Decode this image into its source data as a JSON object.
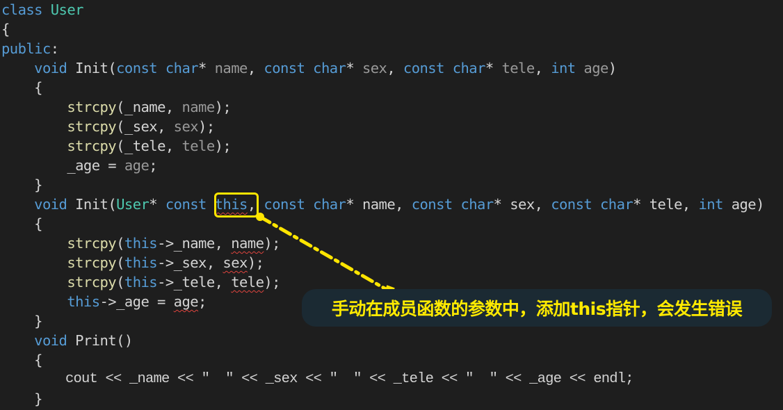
{
  "editor": {
    "language": "C++",
    "lines": [
      [
        {
          "t": "class",
          "c": "kw"
        },
        {
          "t": " ",
          "c": "plain"
        },
        {
          "t": "User",
          "c": "type"
        }
      ],
      [
        {
          "t": "{",
          "c": "punct"
        }
      ],
      [
        {
          "t": "public",
          "c": "kw"
        },
        {
          "t": ":",
          "c": "plain"
        }
      ],
      [
        {
          "t": "    ",
          "c": "plain"
        },
        {
          "t": "void",
          "c": "kw"
        },
        {
          "t": " ",
          "c": "plain"
        },
        {
          "t": "Init",
          "c": "plain"
        },
        {
          "t": "(",
          "c": "punct"
        },
        {
          "t": "const",
          "c": "kw"
        },
        {
          "t": " ",
          "c": "plain"
        },
        {
          "t": "char",
          "c": "kw"
        },
        {
          "t": "* ",
          "c": "plain"
        },
        {
          "t": "name",
          "c": "param-dim"
        },
        {
          "t": ", ",
          "c": "plain"
        },
        {
          "t": "const",
          "c": "kw"
        },
        {
          "t": " ",
          "c": "plain"
        },
        {
          "t": "char",
          "c": "kw"
        },
        {
          "t": "* ",
          "c": "plain"
        },
        {
          "t": "sex",
          "c": "param-dim"
        },
        {
          "t": ", ",
          "c": "plain"
        },
        {
          "t": "const",
          "c": "kw"
        },
        {
          "t": " ",
          "c": "plain"
        },
        {
          "t": "char",
          "c": "kw"
        },
        {
          "t": "* ",
          "c": "plain"
        },
        {
          "t": "tele",
          "c": "param-dim"
        },
        {
          "t": ", ",
          "c": "plain"
        },
        {
          "t": "int",
          "c": "kw"
        },
        {
          "t": " ",
          "c": "plain"
        },
        {
          "t": "age",
          "c": "param-dim"
        },
        {
          "t": ")",
          "c": "punct"
        }
      ],
      [
        {
          "t": "    {",
          "c": "punct"
        }
      ],
      [
        {
          "t": "        ",
          "c": "plain"
        },
        {
          "t": "strcpy",
          "c": "fn"
        },
        {
          "t": "(_name, ",
          "c": "plain"
        },
        {
          "t": "name",
          "c": "param-dim"
        },
        {
          "t": ");",
          "c": "plain"
        }
      ],
      [
        {
          "t": "        ",
          "c": "plain"
        },
        {
          "t": "strcpy",
          "c": "fn"
        },
        {
          "t": "(_sex, ",
          "c": "plain"
        },
        {
          "t": "sex",
          "c": "param-dim"
        },
        {
          "t": ");",
          "c": "plain"
        }
      ],
      [
        {
          "t": "        ",
          "c": "plain"
        },
        {
          "t": "strcpy",
          "c": "fn"
        },
        {
          "t": "(_tele, ",
          "c": "plain"
        },
        {
          "t": "tele",
          "c": "param-dim"
        },
        {
          "t": ");",
          "c": "plain"
        }
      ],
      [
        {
          "t": "        _age = ",
          "c": "plain"
        },
        {
          "t": "age",
          "c": "param-dim"
        },
        {
          "t": ";",
          "c": "plain"
        }
      ],
      [
        {
          "t": "    }",
          "c": "punct"
        }
      ],
      [
        {
          "t": "    ",
          "c": "plain"
        },
        {
          "t": "void",
          "c": "kw"
        },
        {
          "t": " ",
          "c": "plain"
        },
        {
          "t": "Init",
          "c": "plain"
        },
        {
          "t": "(",
          "c": "punct"
        },
        {
          "t": "User",
          "c": "type"
        },
        {
          "t": "* ",
          "c": "plain"
        },
        {
          "t": "const",
          "c": "kw"
        },
        {
          "t": " ",
          "c": "plain"
        },
        {
          "t": "this",
          "c": "kw",
          "err": true
        },
        {
          "t": ", ",
          "c": "plain"
        },
        {
          "t": "const",
          "c": "kw"
        },
        {
          "t": " ",
          "c": "plain"
        },
        {
          "t": "char",
          "c": "kw"
        },
        {
          "t": "* ",
          "c": "plain"
        },
        {
          "t": "name",
          "c": "plain"
        },
        {
          "t": ", ",
          "c": "plain"
        },
        {
          "t": "const",
          "c": "kw"
        },
        {
          "t": " ",
          "c": "plain"
        },
        {
          "t": "char",
          "c": "kw"
        },
        {
          "t": "* ",
          "c": "plain"
        },
        {
          "t": "sex",
          "c": "plain"
        },
        {
          "t": ", ",
          "c": "plain"
        },
        {
          "t": "const",
          "c": "kw"
        },
        {
          "t": " ",
          "c": "plain"
        },
        {
          "t": "char",
          "c": "kw"
        },
        {
          "t": "* ",
          "c": "plain"
        },
        {
          "t": "tele",
          "c": "plain"
        },
        {
          "t": ", ",
          "c": "plain"
        },
        {
          "t": "int",
          "c": "kw"
        },
        {
          "t": " ",
          "c": "plain"
        },
        {
          "t": "age",
          "c": "plain"
        },
        {
          "t": ")",
          "c": "punct"
        }
      ],
      [
        {
          "t": "    {",
          "c": "punct"
        }
      ],
      [
        {
          "t": "        ",
          "c": "plain"
        },
        {
          "t": "strcpy",
          "c": "fn"
        },
        {
          "t": "(",
          "c": "plain"
        },
        {
          "t": "this",
          "c": "kw"
        },
        {
          "t": "->_name, ",
          "c": "plain"
        },
        {
          "t": "name",
          "c": "plain",
          "err": true
        },
        {
          "t": ");",
          "c": "plain"
        }
      ],
      [
        {
          "t": "        ",
          "c": "plain"
        },
        {
          "t": "strcpy",
          "c": "fn"
        },
        {
          "t": "(",
          "c": "plain"
        },
        {
          "t": "this",
          "c": "kw"
        },
        {
          "t": "->_sex, ",
          "c": "plain"
        },
        {
          "t": "sex",
          "c": "plain",
          "err": true
        },
        {
          "t": ");",
          "c": "plain"
        }
      ],
      [
        {
          "t": "        ",
          "c": "plain"
        },
        {
          "t": "strcpy",
          "c": "fn"
        },
        {
          "t": "(",
          "c": "plain"
        },
        {
          "t": "this",
          "c": "kw"
        },
        {
          "t": "->_tele, ",
          "c": "plain"
        },
        {
          "t": "tele",
          "c": "plain",
          "err": true
        },
        {
          "t": ");",
          "c": "plain"
        }
      ],
      [
        {
          "t": "        ",
          "c": "plain"
        },
        {
          "t": "this",
          "c": "kw"
        },
        {
          "t": "->_age = ",
          "c": "plain"
        },
        {
          "t": "age",
          "c": "plain",
          "err": true
        },
        {
          "t": ";",
          "c": "plain"
        }
      ],
      [
        {
          "t": "    }",
          "c": "punct"
        }
      ],
      [
        {
          "t": "    ",
          "c": "plain"
        },
        {
          "t": "void",
          "c": "kw"
        },
        {
          "t": " ",
          "c": "plain"
        },
        {
          "t": "Print",
          "c": "plain"
        },
        {
          "t": "()",
          "c": "punct"
        }
      ],
      [
        {
          "t": "    {",
          "c": "punct"
        }
      ],
      [
        {
          "t": "        cout << _name << ",
          "c": "plain"
        },
        {
          "t": "\"  \"",
          "c": "plain"
        },
        {
          "t": " << _sex << ",
          "c": "plain"
        },
        {
          "t": "\"  \"",
          "c": "plain"
        },
        {
          "t": " << _tele << ",
          "c": "plain"
        },
        {
          "t": "\"  \"",
          "c": "plain"
        },
        {
          "t": " << _age << endl;",
          "c": "plain"
        }
      ],
      [
        {
          "t": "    }",
          "c": "punct"
        }
      ]
    ]
  },
  "annotation": {
    "highlighted_token": "this",
    "callout_text": "手动在成员函数的参数中，添加this指针，会发生错误",
    "color": "#ffe500",
    "callout_bg": "#1b2a33"
  }
}
